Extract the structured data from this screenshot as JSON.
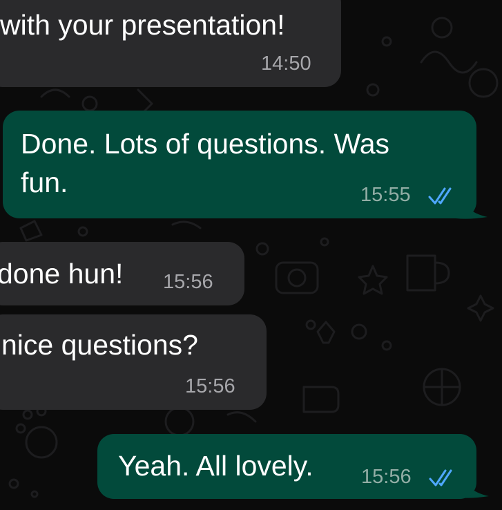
{
  "colors": {
    "background": "#0b0b0b",
    "incoming_bubble": "#2a2a2c",
    "outgoing_bubble": "#024a3b",
    "read_ticks": "#4fa7ff",
    "doodle": "#1c1c1e"
  },
  "messages": [
    {
      "direction": "incoming",
      "lines": [
        "with your presentation!"
      ],
      "time": "14:50"
    },
    {
      "direction": "outgoing",
      "lines": [
        "Done. Lots of questions. Was",
        "fun."
      ],
      "time": "15:55",
      "status_icon": "double-check-read-icon"
    },
    {
      "direction": "incoming",
      "lines": [
        "done hun!"
      ],
      "time": "15:56"
    },
    {
      "direction": "incoming",
      "lines": [
        "nice questions?"
      ],
      "time": "15:56"
    },
    {
      "direction": "outgoing",
      "lines": [
        "Yeah. All lovely."
      ],
      "time": "15:56",
      "status_icon": "double-check-read-icon"
    }
  ]
}
